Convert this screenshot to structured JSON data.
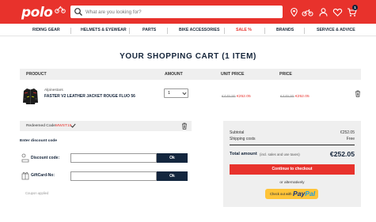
{
  "header": {
    "logo": "polo",
    "search_placeholder": "What are you looking for?",
    "icons": [
      "location-icon",
      "motorcycle-icon",
      "account-icon",
      "heart-icon",
      "cart-icon"
    ],
    "cart_count": "1",
    "brand_color": "#e8322c"
  },
  "nav": {
    "items": [
      "RIDING GEAR",
      "HELMETS & EYEWEAR",
      "PARTS",
      "BIKE ACCESSORIES",
      "SALE %",
      "BRANDS",
      "SERVICE & ADVICE"
    ]
  },
  "page_title": "YOUR SHOPPING CART (1 ITEM)",
  "table": {
    "headers": [
      "PRODUCT",
      "AMOUNT",
      "UNIT PRICE",
      "PRICE"
    ],
    "items": [
      {
        "brand": "Alpinestars",
        "name": "FASTER V2 LEATHER JACKET ROUGE FLUO 56",
        "quantity": "1",
        "unit_old": "€449.95",
        "unit_new": "€252.05",
        "price_old": "€449.95",
        "price_new": "€252.05"
      }
    ]
  },
  "discount": {
    "redeemed_label": "Redeemed Code:",
    "redeemed_code": "MWST19",
    "enter_label": "Enter discount code",
    "discount_label": "Discount code:",
    "giftcard_label": "GiftCard-No:",
    "ok_label": "Ok",
    "coupon_note": "Coupon applied"
  },
  "summary": {
    "subtotal_label": "Subtotal",
    "subtotal_value": "€252.05",
    "shipping_label": "Shipping costs",
    "shipping_value": "Free",
    "total_label": "Total amount",
    "total_note": "(incl. sales and use taxes)",
    "total_value": "€252.05",
    "checkout_label": "Continue to checkout",
    "alt_label": "or alternatively",
    "paypal_prefix": "Check out with",
    "paypal_label_1": "Pay",
    "paypal_label_2": "Pal"
  }
}
